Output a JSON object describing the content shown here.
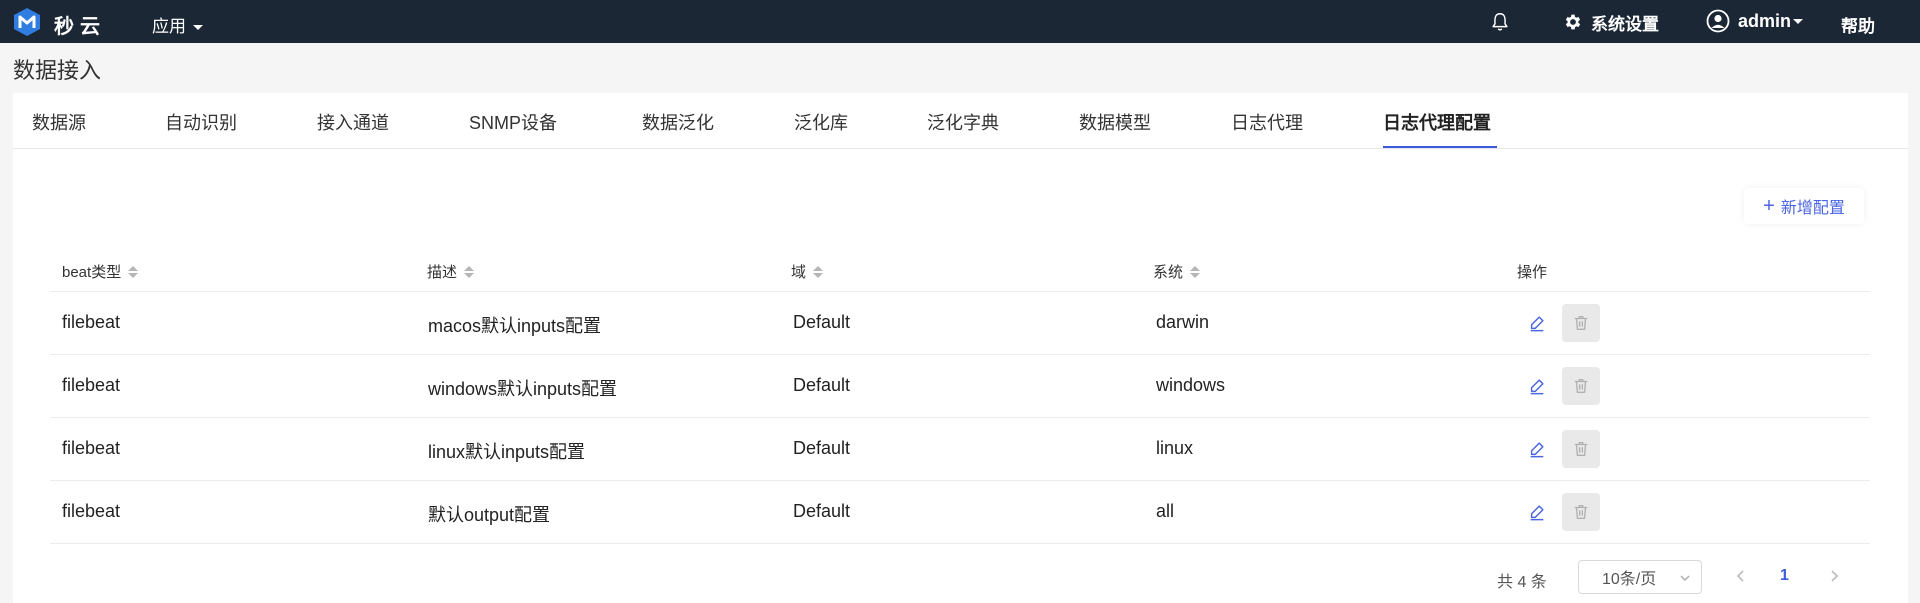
{
  "topbar": {
    "brand": "秒云",
    "app_menu": "应用",
    "settings": "系统设置",
    "user": "admin",
    "help": "帮助",
    "background": "#1b2735"
  },
  "page": {
    "title": "数据接入"
  },
  "tabs": [
    {
      "label": "数据源"
    },
    {
      "label": "自动识别"
    },
    {
      "label": "接入通道"
    },
    {
      "label": "SNMP设备"
    },
    {
      "label": "数据泛化"
    },
    {
      "label": "泛化库"
    },
    {
      "label": "泛化字典"
    },
    {
      "label": "数据模型"
    },
    {
      "label": "日志代理"
    },
    {
      "label": "日志代理配置",
      "active": true
    }
  ],
  "toolbar": {
    "add_label": "新增配置"
  },
  "table": {
    "columns": [
      "beat类型",
      "描述",
      "域",
      "系统",
      "操作"
    ],
    "rows": [
      {
        "beat": "filebeat",
        "desc": "macos默认inputs配置",
        "domain": "Default",
        "system": "darwin"
      },
      {
        "beat": "filebeat",
        "desc": "windows默认inputs配置",
        "domain": "Default",
        "system": "windows"
      },
      {
        "beat": "filebeat",
        "desc": "linux默认inputs配置",
        "domain": "Default",
        "system": "linux"
      },
      {
        "beat": "filebeat",
        "desc": "默认output配置",
        "domain": "Default",
        "system": "all"
      }
    ]
  },
  "pagination": {
    "total": "共 4 条",
    "page_size": "10条/页",
    "current_page": "1"
  },
  "colors": {
    "accent": "#3b5bdb",
    "link": "#4a64e3"
  },
  "icons": {
    "bell": "bell-icon",
    "gear": "gear-icon",
    "user": "user-avatar-icon",
    "edit": "pencil-icon",
    "delete": "trash-icon"
  }
}
